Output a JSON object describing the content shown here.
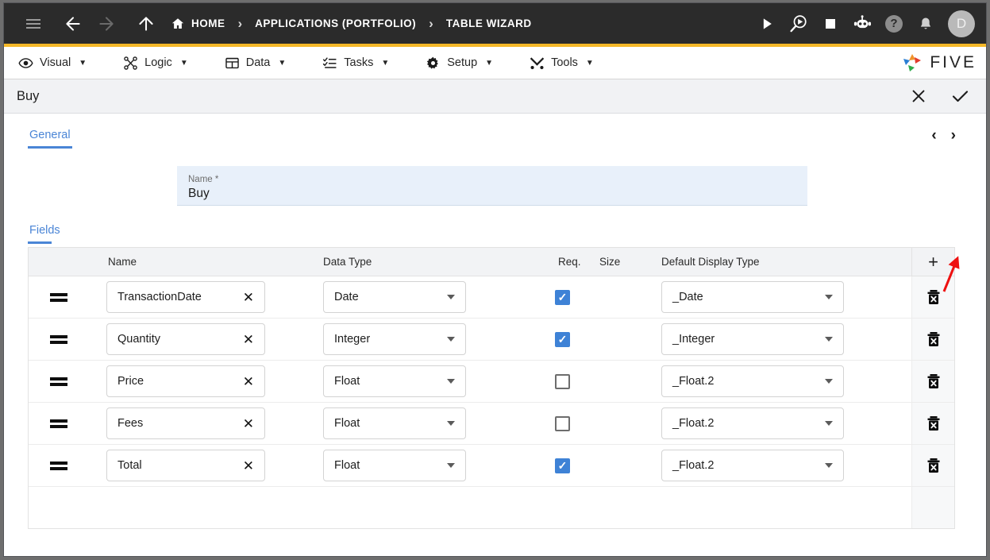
{
  "topbar": {
    "menu_icon": "hamburger-icon",
    "back_icon": "arrow-left-icon",
    "forward_icon": "arrow-right-icon",
    "up_icon": "arrow-up-icon",
    "breadcrumbs": [
      {
        "label": "HOME",
        "icon": "home-icon"
      },
      {
        "label": "APPLICATIONS (PORTFOLIO)",
        "icon": ""
      },
      {
        "label": "TABLE WIZARD",
        "icon": ""
      }
    ],
    "separator": "›",
    "actions": [
      {
        "name": "run-icon",
        "label": ""
      },
      {
        "name": "debug-run-icon",
        "label": ""
      },
      {
        "name": "stop-icon",
        "label": ""
      },
      {
        "name": "robot-icon",
        "label": ""
      },
      {
        "name": "help-icon",
        "label": "?"
      },
      {
        "name": "notifications-bell-icon",
        "label": ""
      }
    ],
    "avatar_initial": "D",
    "accent_color": "#f5b828",
    "background_color": "#2b2b2b"
  },
  "menubar": {
    "items": [
      {
        "label": "Visual",
        "icon": "eye-icon",
        "caret": "▼"
      },
      {
        "label": "Logic",
        "icon": "logic-graph-icon",
        "caret": "▼"
      },
      {
        "label": "Data",
        "icon": "table-grid-icon",
        "caret": "▼"
      },
      {
        "label": "Tasks",
        "icon": "checklist-icon",
        "caret": "▼"
      },
      {
        "label": "Setup",
        "icon": "gear-icon",
        "caret": "▼"
      },
      {
        "label": "Tools",
        "icon": "tools-wrench-icon",
        "caret": "▼"
      }
    ],
    "brand_text": "FIVE"
  },
  "page_header": {
    "title": "Buy",
    "close_label": "✕",
    "confirm_label": "✓"
  },
  "general_tab": {
    "label": "General",
    "prev_label": "‹",
    "next_label": "›"
  },
  "name_field": {
    "label": "Name *",
    "value": "Buy",
    "placeholder": "Name"
  },
  "fields_section": {
    "tab_label": "Fields",
    "add_label": "+",
    "columns": [
      "Name",
      "Data Type",
      "Req.",
      "Size",
      "Default Display Type"
    ],
    "delete_icon": "trash-delete-icon",
    "drag_icon": "drag-handle-icon",
    "clear_icon": "clear-x-icon",
    "rows": [
      {
        "name": "TransactionDate",
        "data_type": "Date",
        "required": true,
        "size": "",
        "display_type": "_Date"
      },
      {
        "name": "Quantity",
        "data_type": "Integer",
        "required": true,
        "size": "",
        "display_type": "_Integer"
      },
      {
        "name": "Price",
        "data_type": "Float",
        "required": false,
        "size": "",
        "display_type": "_Float.2"
      },
      {
        "name": "Fees",
        "data_type": "Float",
        "required": false,
        "size": "",
        "display_type": "_Float.2"
      },
      {
        "name": "Total",
        "data_type": "Float",
        "required": true,
        "size": "",
        "display_type": "_Float.2"
      }
    ]
  },
  "annotation": {
    "arrow_color": "#ee1111",
    "points_to": "next-record-button"
  },
  "colors": {
    "accent": "#f5b828",
    "link_blue": "#4a85d6",
    "checkbox_blue": "#3e82d6",
    "field_highlight": "#e8f0fa"
  }
}
